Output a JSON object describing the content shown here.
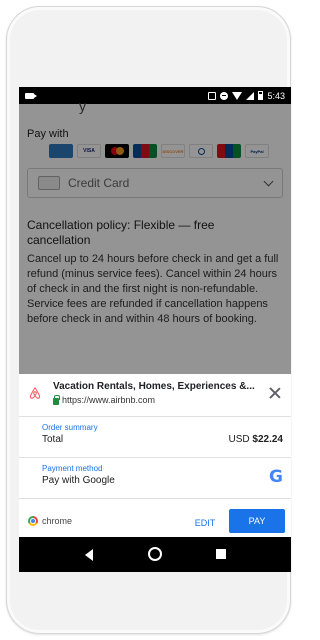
{
  "status_bar": {
    "time": "5:43"
  },
  "background_page": {
    "heading_fragment": "y",
    "pay_with": "Pay with",
    "cards": [
      {
        "name": "AMEX",
        "color": "#2e77bb"
      },
      {
        "name": "VISA",
        "color": "#1a1f71"
      },
      {
        "name": "MC",
        "color": "#eb001b"
      },
      {
        "name": "JCB",
        "color": "#0a5c36"
      },
      {
        "name": "DISCOVER",
        "color": "#f58220"
      },
      {
        "name": "DINERS",
        "color": "#004a97"
      },
      {
        "name": "UNIONPAY",
        "color": "#d7141a"
      },
      {
        "name": "PayPal",
        "color": "#003087"
      }
    ],
    "payment_select": {
      "value": "Credit Card"
    },
    "cancellation_title": "Cancellation policy: Flexible — free cancellation",
    "cancellation_body": "Cancel up to 24 hours before check in and get a full refund (minus service fees). Cancel within 24 hours of check in and the first night is non-refundable. Service fees are refunded if cancellation happens before check in and within 48 hours of booking."
  },
  "payment_sheet": {
    "merchant_title": "Vacation Rentals, Homes, Experiences &...",
    "merchant_url": "https://www.airbnb.com",
    "order_summary_label": "Order summary",
    "total_label": "Total",
    "total_currency": "USD",
    "total_amount": "$22.24",
    "payment_method_label": "Payment method",
    "payment_method_value": "Pay with Google",
    "google_logo": "G",
    "browser_label": "chrome",
    "edit_label": "EDIT",
    "pay_label": "PAY"
  },
  "colors": {
    "accent": "#1a73e8",
    "airbnb": "#ff5a5f",
    "lock": "#1e8e3e"
  }
}
